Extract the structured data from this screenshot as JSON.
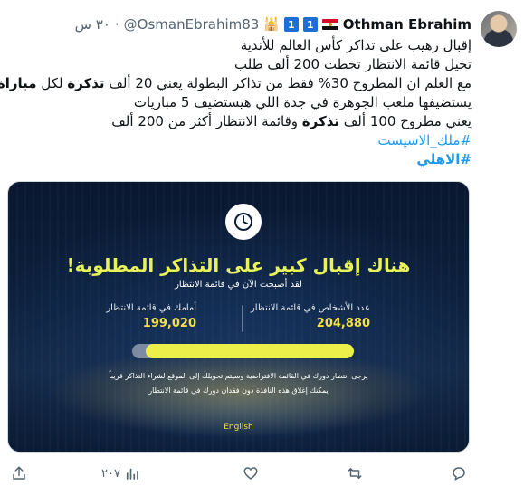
{
  "author": {
    "name": "Othman Ebrahim",
    "handle": "@OsmanEbrahim83",
    "badge_one": "1",
    "badge_two": "1",
    "time": "٣٠ س"
  },
  "tweet": {
    "lines": [
      "إقبال رهيب على تذاكر كأس العالم للأندية",
      "تخيل قائمة الانتظار تخطت 200 ألف طلب",
      "يستضيفها ملعب الجوهرة في جدة اللي هيستضيف 5 مباريات"
    ],
    "line3": {
      "part1": "مع العلم ان المطروح 30% فقط من تذاكر البطولة يعني 20 ألف ",
      "bold1": "تذكرة",
      "part2": " لكل ",
      "bold2": "مباراة"
    },
    "line5": {
      "part1": "يعني مطروح 100 ألف ",
      "bold1": "تذكرة",
      "part2": " وقائمة الانتظار أكثر من 200 ألف"
    },
    "hashtag1": "#ملك_الاسيست",
    "hashtag2": "#الاهلي"
  },
  "card": {
    "title": "هناك إقبال كبير على التذاكر المطلوبة!",
    "subtitle": "لقد أصبحت الآن في قائمة الانتظار",
    "stat_people_label": "عدد الأشخاص في قائمة الانتظار",
    "stat_people_value": "204,880",
    "stat_ahead_label": "أمامك في قائمة الانتظار",
    "stat_ahead_value": "199,020",
    "progress_fraction": 0.94,
    "notice_line1": "يرجى انتظار دورك في القائمة الافتراضية وسيتم تحويلك إلى الموقع لشراء التذاكر قريباً",
    "notice_line2": "يمكنك إغلاق هذه النافذة دون فقدان دورك في قائمة الانتظار",
    "english_link": "English"
  },
  "actions": {
    "views_count": "٢٠٧"
  },
  "colors": {
    "accent": "#1d9bf0",
    "card_title": "#e9f25a",
    "progress": "#ecef4a"
  }
}
